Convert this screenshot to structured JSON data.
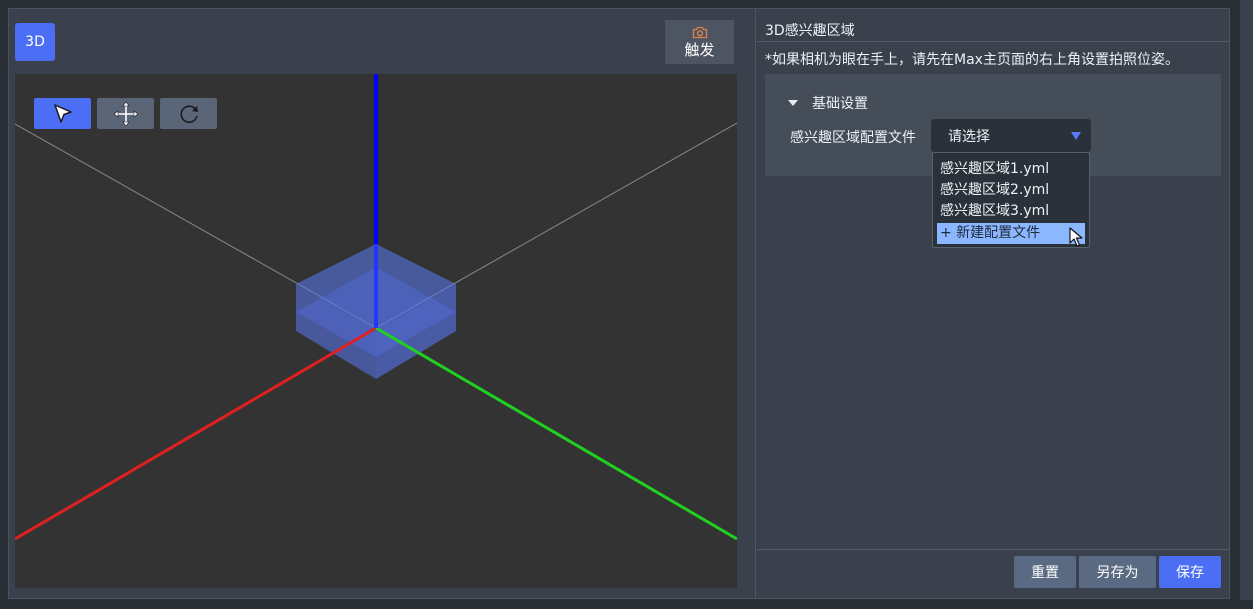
{
  "left": {
    "mode_button": "3D",
    "trigger_button": "触发",
    "trigger_icon": "camera-icon",
    "tools": [
      {
        "name": "select-tool",
        "icon": "cursor-arrow-icon",
        "active": true
      },
      {
        "name": "move-tool",
        "icon": "move-arrows-icon",
        "active": false
      },
      {
        "name": "rotate-tool",
        "icon": "rotate-icon",
        "active": false
      }
    ]
  },
  "right": {
    "title": "3D感兴趣区域",
    "note": "*如果相机为眼在手上，请先在Max主页面的右上角设置拍照位姿。",
    "section_title": "基础设置",
    "field_label": "感兴趣区域配置文件",
    "select_placeholder": "请选择",
    "options": [
      "感兴趣区域1.yml",
      "感兴趣区域2.yml",
      "感兴趣区域3.yml"
    ],
    "new_option": "+ 新建配置文件"
  },
  "footer": {
    "reset": "重置",
    "save_as": "另存为",
    "save": "保存"
  },
  "colors": {
    "accent": "#4b6ef5",
    "x_axis": "#e02020",
    "y_axis": "#20d020",
    "z_axis": "#0000ff"
  }
}
